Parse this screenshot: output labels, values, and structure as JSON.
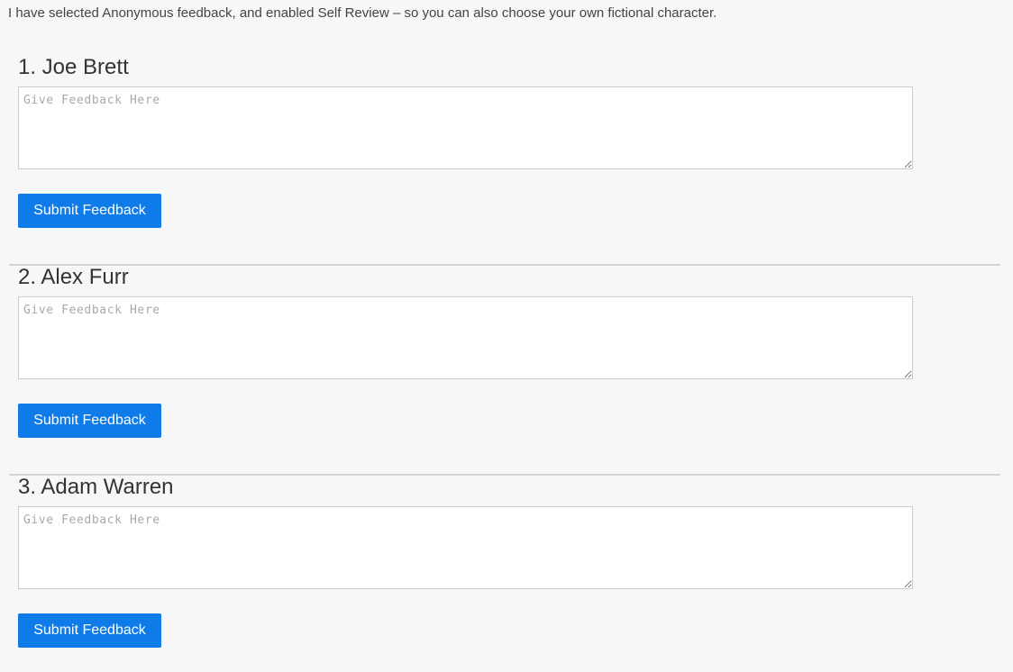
{
  "intro_text": "I have selected Anonymous feedback, and enabled Self Review – so you can also choose your own fictional character.",
  "people": [
    {
      "name": "1. Joe Brett",
      "feedback_value": "",
      "feedback_placeholder": "Give Feedback Here",
      "submit_label": "Submit Feedback"
    },
    {
      "name": "2. Alex Furr",
      "feedback_value": "",
      "feedback_placeholder": "Give Feedback Here",
      "submit_label": "Submit Feedback"
    },
    {
      "name": "3. Adam Warren",
      "feedback_value": "",
      "feedback_placeholder": "Give Feedback Here",
      "submit_label": "Submit Feedback"
    }
  ],
  "colors": {
    "accent": "#0f7be8",
    "background": "#f7f7f7",
    "divider": "#d3d3d3"
  }
}
